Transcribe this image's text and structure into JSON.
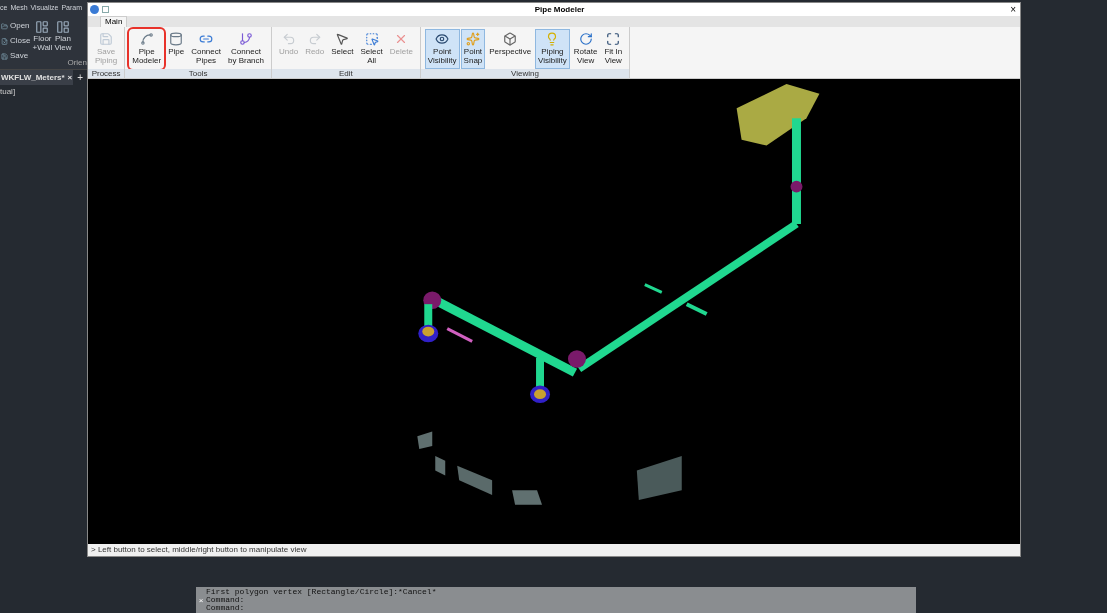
{
  "background_app": {
    "menu": [
      "ce",
      "Mesh",
      "Visualize",
      "Param"
    ],
    "file_buttons": [
      "Open",
      "Close",
      "Save"
    ],
    "ribbon_buttons": [
      {
        "lines": [
          "Floor",
          "+Wall"
        ]
      },
      {
        "lines": [
          "Plan",
          "View"
        ]
      }
    ],
    "group_label": "Orien",
    "document_tab": {
      "label": "WKFLW_Meters*",
      "close": "×"
    },
    "new_tab": "+",
    "viewport_label": "tual]"
  },
  "window": {
    "title": "Pipe Modeler",
    "close": "×",
    "ribbon_tabs": [
      {
        "label": "Main",
        "selected": true
      }
    ],
    "groups": [
      {
        "label": "Process",
        "buttons": [
          {
            "lines": [
              "Save",
              "Piping"
            ],
            "disabled": true,
            "selected": false,
            "highlighted": false
          }
        ]
      },
      {
        "label": "Tools",
        "buttons": [
          {
            "lines": [
              "Pipe",
              "Modeler"
            ],
            "disabled": false,
            "selected": false,
            "highlighted": true
          },
          {
            "lines": [
              "Pipe"
            ],
            "disabled": false,
            "selected": false,
            "highlighted": false
          },
          {
            "lines": [
              "Connect",
              "Pipes"
            ],
            "disabled": false,
            "selected": false,
            "highlighted": false
          },
          {
            "lines": [
              "Connect",
              "by Branch"
            ],
            "disabled": false,
            "selected": false,
            "highlighted": false
          }
        ]
      },
      {
        "label": "Edit",
        "buttons": [
          {
            "lines": [
              "Undo"
            ],
            "disabled": true,
            "selected": false,
            "highlighted": false
          },
          {
            "lines": [
              "Redo"
            ],
            "disabled": true,
            "selected": false,
            "highlighted": false
          },
          {
            "lines": [
              "Select"
            ],
            "disabled": false,
            "selected": false,
            "highlighted": false
          },
          {
            "lines": [
              "Select",
              "All"
            ],
            "disabled": false,
            "selected": false,
            "highlighted": false
          },
          {
            "lines": [
              "Delete"
            ],
            "disabled": true,
            "selected": false,
            "highlighted": false
          }
        ]
      },
      {
        "label": "Viewing",
        "buttons": [
          {
            "lines": [
              "Point",
              "Visibility"
            ],
            "disabled": false,
            "selected": true,
            "highlighted": false
          },
          {
            "lines": [
              "Point",
              "Snap"
            ],
            "disabled": false,
            "selected": true,
            "highlighted": false
          },
          {
            "lines": [
              "Perspective"
            ],
            "disabled": false,
            "selected": false,
            "highlighted": false
          },
          {
            "lines": [
              "Piping",
              "Visibility"
            ],
            "disabled": false,
            "selected": true,
            "highlighted": false
          },
          {
            "lines": [
              "Rotate",
              "View"
            ],
            "disabled": false,
            "selected": false,
            "highlighted": false
          },
          {
            "lines": [
              "Fit In",
              "View"
            ],
            "disabled": false,
            "selected": false,
            "highlighted": false
          }
        ]
      }
    ],
    "status": "> Left button to select, middle/right button to manipulate view"
  },
  "command_line": {
    "close": "×",
    "lines": [
      "First polygon vertex [Rectangle/Circle]:*Cancel*",
      "Command:",
      "Command:"
    ]
  }
}
